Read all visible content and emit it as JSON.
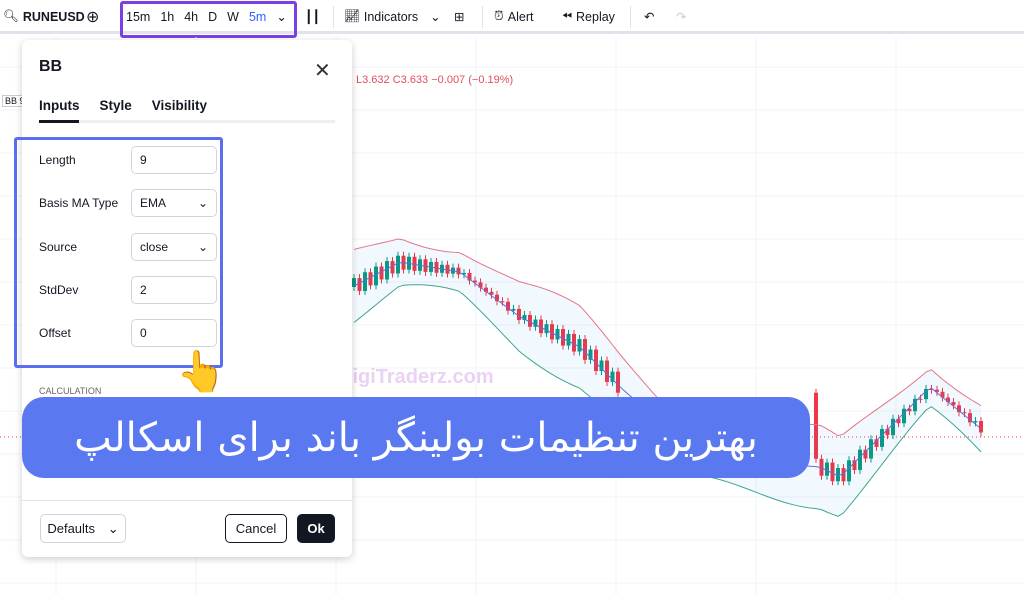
{
  "toolbar": {
    "symbol": "RUNEUSD",
    "intervals": [
      "15m",
      "1h",
      "4h",
      "D",
      "W"
    ],
    "active_interval": "5m",
    "indicators": "Indicators",
    "alert": "Alert",
    "replay": "Replay"
  },
  "legend": {
    "text": "L3.632 C3.633 −0.007 (−0.19%)"
  },
  "left_labels": {
    "bb": "BB 9"
  },
  "dialog": {
    "title": "BB",
    "tabs": [
      "Inputs",
      "Style",
      "Visibility"
    ],
    "fields": [
      {
        "label": "Length",
        "value": "9"
      },
      {
        "label": "Basis MA Type",
        "value": "EMA",
        "dropdown": true
      },
      {
        "label": "Source",
        "value": "close",
        "dropdown": true
      },
      {
        "label": "StdDev",
        "value": "2"
      },
      {
        "label": "Offset",
        "value": "0"
      }
    ],
    "section": "CALCULATION",
    "defaults": "Defaults",
    "cancel": "Cancel",
    "ok": "Ok"
  },
  "watermark": "DigiTraderz.com",
  "banner": "بهترین تنظیمات بولینگر باند برای اسکالپ",
  "colors": {
    "up": "#089981",
    "down": "#f23645",
    "upper_band": "#e57388",
    "lower_band": "#3fa58f",
    "basis": "#5d6fd8",
    "highlight": "#7b3fe4",
    "banner": "#5a79f1"
  }
}
